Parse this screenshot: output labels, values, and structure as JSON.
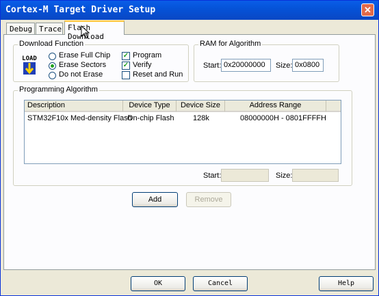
{
  "window": {
    "title": "Cortex-M Target Driver Setup"
  },
  "tabs": [
    {
      "label": "Debug"
    },
    {
      "label": "Trace"
    },
    {
      "label": "Flash Download",
      "active": true
    }
  ],
  "download_function": {
    "group_label": "Download Function",
    "logo_text": "LOAD",
    "radios": [
      {
        "label": "Erase Full Chip",
        "checked": false
      },
      {
        "label": "Erase Sectors",
        "checked": true
      },
      {
        "label": "Do not Erase",
        "checked": false
      }
    ],
    "checks": [
      {
        "label": "Program",
        "checked": true
      },
      {
        "label": "Verify",
        "checked": true
      },
      {
        "label": "Reset and Run",
        "checked": false
      }
    ]
  },
  "ram": {
    "group_label": "RAM for Algorithm",
    "start_label": "Start:",
    "start_value": "0x20000000",
    "size_label": "Size:",
    "size_value": "0x0800"
  },
  "programming_algorithm": {
    "group_label": "Programming Algorithm",
    "columns": [
      "Description",
      "Device Type",
      "Device Size",
      "Address Range"
    ],
    "rows": [
      [
        "STM32F10x Med-density Flash",
        "On-chip Flash",
        "128k",
        "08000000H - 0801FFFFH"
      ]
    ],
    "start_label": "Start:",
    "start_value": "",
    "size_label": "Size:",
    "size_value": ""
  },
  "buttons": {
    "add": "Add",
    "remove": "Remove",
    "ok": "OK",
    "cancel": "Cancel",
    "help": "Help"
  }
}
